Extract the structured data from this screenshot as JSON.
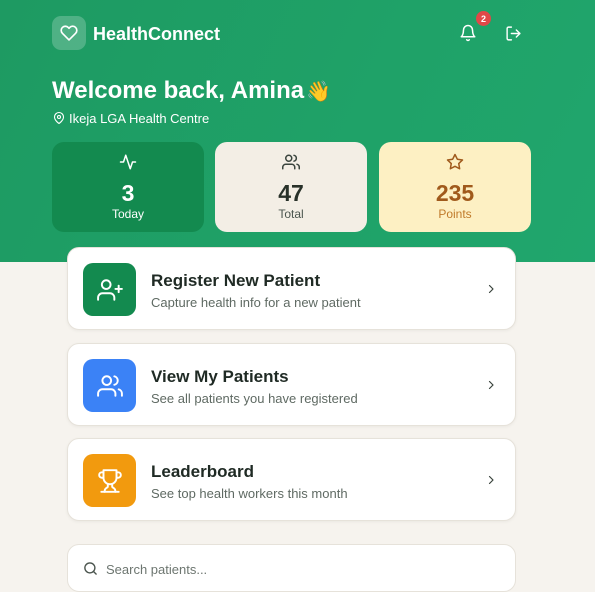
{
  "app": {
    "name": "HealthConnect"
  },
  "header": {
    "notification_count": "2"
  },
  "greeting": {
    "text": "Welcome back, Amina",
    "emoji": "👋",
    "location": "Ikeja LGA Health Centre"
  },
  "stats": [
    {
      "value": "3",
      "label": "Today",
      "icon": "activity-icon"
    },
    {
      "value": "47",
      "label": "Total",
      "icon": "users-icon"
    },
    {
      "value": "235",
      "label": "Points",
      "icon": "star-icon"
    }
  ],
  "actions": [
    {
      "title": "Register New Patient",
      "subtitle": "Capture health info for a new patient",
      "icon": "user-plus-icon",
      "color": "#138a4f"
    },
    {
      "title": "View My Patients",
      "subtitle": "See all patients you have registered",
      "icon": "users-icon",
      "color": "#3b82f6"
    },
    {
      "title": "Leaderboard",
      "subtitle": "See top health workers this month",
      "icon": "trophy-icon",
      "color": "#f29a0e"
    }
  ],
  "search": {
    "placeholder": "Search patients..."
  },
  "colors": {
    "brand": "#1fa268",
    "today_card": "#138a4f",
    "points_text": "#a05a1c",
    "badge": "#e04848"
  }
}
